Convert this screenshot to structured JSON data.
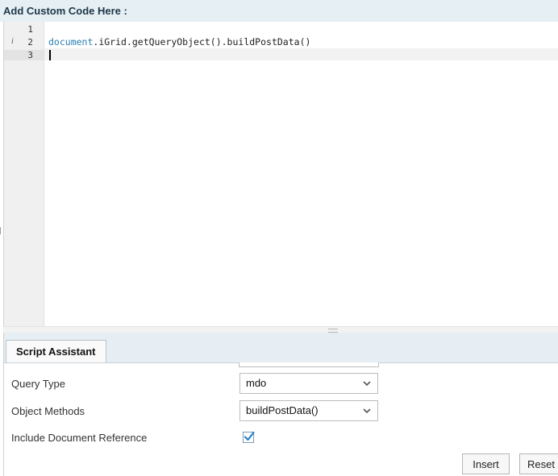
{
  "header": {
    "title": "Add Custom Code Here :"
  },
  "editor": {
    "line_numbers": [
      "1",
      "2",
      "3"
    ],
    "info_marker": "i",
    "code_line2_keyword": "document",
    "code_line2_rest": ".iGrid.getQueryObject().buildPostData()"
  },
  "panel": {
    "tab_label": "Script Assistant",
    "fields": {
      "query_type_label": "Query Type",
      "query_type_value": "mdo",
      "object_methods_label": "Object Methods",
      "object_methods_value": "buildPostData()",
      "include_doc_ref_label": "Include Document Reference",
      "include_doc_ref_checked": true
    },
    "buttons": {
      "insert": "Insert",
      "reset": "Reset"
    }
  },
  "colors": {
    "header_bg": "#e6f0f4",
    "keyword": "#2a7fb0",
    "check": "#2a7fc9"
  },
  "icons": [
    "chevron-down-icon",
    "checkmark-icon"
  ]
}
